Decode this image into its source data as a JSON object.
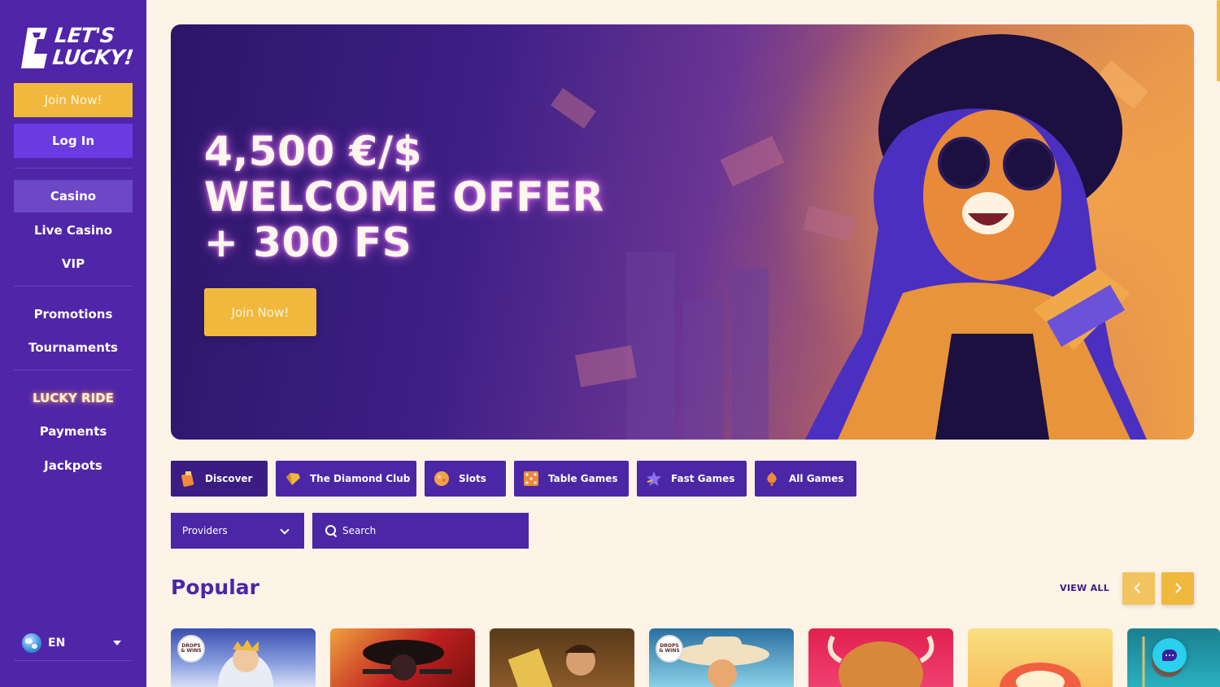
{
  "brand": {
    "logo_line1": "LET'S",
    "logo_line2": "LUCKY!"
  },
  "sidebar": {
    "join_label": "Join Now!",
    "login_label": "Log In",
    "nav": [
      {
        "label": "Casino",
        "active": true
      },
      {
        "label": "Live Casino"
      },
      {
        "label": "VIP"
      },
      {
        "label": "Promotions"
      },
      {
        "label": "Tournaments"
      },
      {
        "label": "LUCKY RIDE"
      },
      {
        "label": "Payments"
      },
      {
        "label": "Jackpots"
      }
    ],
    "language": "EN"
  },
  "hero": {
    "line1": "4,500 €/$",
    "line2": "WELCOME OFFER",
    "line3": "+ 300 FS",
    "cta_label": "Join Now!"
  },
  "categories": [
    {
      "label": "Discover",
      "icon": "discover-icon",
      "active": true
    },
    {
      "label": "The Diamond Club",
      "icon": "diamond-icon"
    },
    {
      "label": "Slots",
      "icon": "slots-icon"
    },
    {
      "label": "Table Games",
      "icon": "table-games-icon"
    },
    {
      "label": "Fast Games",
      "icon": "fast-games-icon"
    },
    {
      "label": "All Games",
      "icon": "all-games-icon"
    }
  ],
  "filters": {
    "providers_label": "Providers",
    "search_placeholder": "Search"
  },
  "popular": {
    "title": "Popular",
    "view_all_label": "VIEW ALL",
    "badge_text": "DROPS & WINS"
  },
  "colors": {
    "sidebar": "#5025a8",
    "accent_gold": "#f0b93e",
    "primary_purple": "#4b27a6",
    "background": "#fdf3e7",
    "chat": "#2ad0ee"
  }
}
